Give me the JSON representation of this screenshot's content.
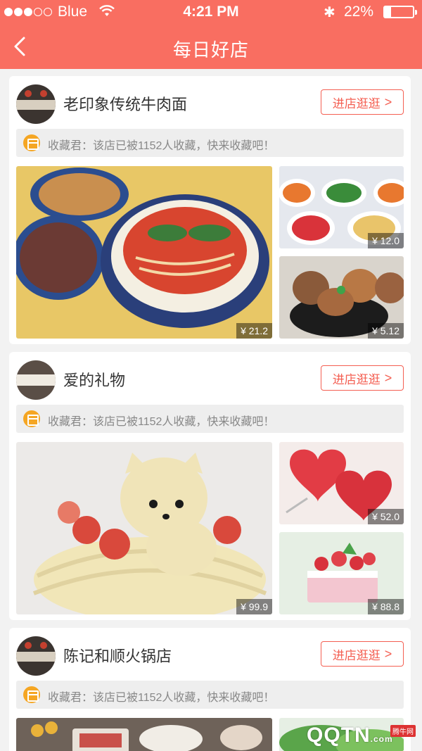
{
  "status_bar": {
    "carrier": "Blue",
    "time": "4:21 PM",
    "battery": "22%"
  },
  "nav": {
    "title": "每日好店"
  },
  "stores": [
    {
      "name": "老印象传统牛肉面",
      "enter_label": "进店逛逛",
      "notice": "收藏君：该店已被1152人收藏，快来收藏吧！",
      "prices": [
        "¥ 21.2",
        "¥ 12.0",
        "¥ 5.12"
      ]
    },
    {
      "name": "爱的礼物",
      "enter_label": "进店逛逛",
      "notice": "收藏君：该店已被1152人收藏，快来收藏吧！",
      "prices": [
        "¥ 99.9",
        "¥ 52.0",
        "¥ 88.8"
      ]
    },
    {
      "name": "陈记和顺火锅店",
      "enter_label": "进店逛逛",
      "notice": "收藏君：该店已被1152人收藏，快来收藏吧！",
      "prices": []
    }
  ],
  "watermark": {
    "brand": "QQTN",
    "domain": ".com",
    "badge": "腾牛网"
  },
  "colors": {
    "accent": "#f96e61",
    "button": "#f45f52",
    "notice_icon": "#f5a623"
  }
}
